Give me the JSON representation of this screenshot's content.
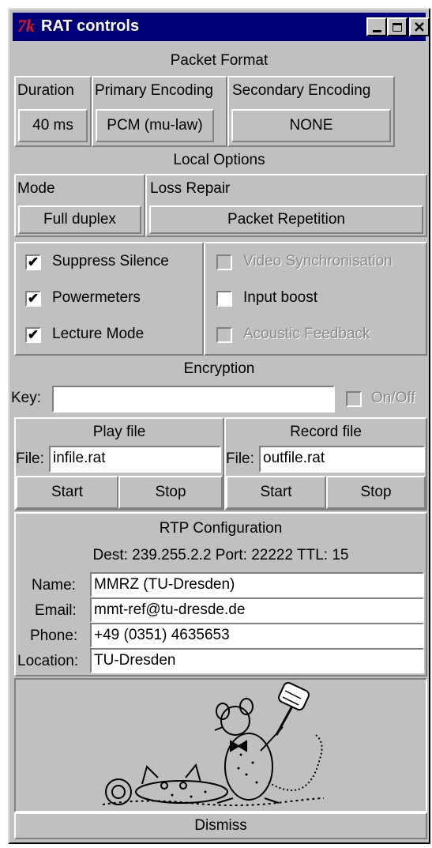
{
  "window": {
    "title": "RAT controls",
    "logo": "7k",
    "icons": [
      "minimize-icon",
      "maximize-icon",
      "close-icon"
    ]
  },
  "packet_format": {
    "heading": "Packet Format",
    "duration": {
      "label": "Duration",
      "value": "40 ms"
    },
    "primary": {
      "label": "Primary Encoding",
      "value": "PCM (mu-law)"
    },
    "secondary": {
      "label": "Secondary Encoding",
      "value": "NONE"
    }
  },
  "local_options": {
    "heading": "Local Options",
    "mode": {
      "label": "Mode",
      "value": "Full duplex"
    },
    "loss_repair": {
      "label": "Loss Repair",
      "value": "Packet Repetition"
    }
  },
  "options": {
    "suppress_silence": {
      "label": "Suppress Silence",
      "checked": true
    },
    "powermeters": {
      "label": "Powermeters",
      "checked": true
    },
    "lecture_mode": {
      "label": "Lecture Mode",
      "checked": true
    },
    "video_sync": {
      "label": "Video Synchronisation",
      "checked": false,
      "enabled": false
    },
    "input_boost": {
      "label": "Input boost",
      "checked": false
    },
    "acoustic_feedback": {
      "label": "Acoustic Feedback",
      "checked": false,
      "enabled": false
    }
  },
  "encryption": {
    "heading": "Encryption",
    "key_label": "Key:",
    "key_value": "",
    "onoff_label": "On/Off"
  },
  "play_file": {
    "heading": "Play file",
    "file_label": "File:",
    "file_value": "infile.rat",
    "start": "Start",
    "stop": "Stop"
  },
  "record_file": {
    "heading": "Record file",
    "file_label": "File:",
    "file_value": "outfile.rat",
    "start": "Start",
    "stop": "Stop"
  },
  "rtp": {
    "heading": "RTP Configuration",
    "dest_line": "Dest: 239.255.2.2  Port: 22222  TTL: 15",
    "name_label": "Name:",
    "name_value": "MMRZ (TU-Dresden)",
    "email_label": "Email:",
    "email_value": "mmt-ref@tu-dresde.de",
    "phone_label": "Phone:",
    "phone_value": "+49 (0351) 4635653",
    "location_label": "Location:",
    "location_value": "TU-Dresden"
  },
  "dismiss": "Dismiss",
  "colors": {
    "titlebar": "#00007b",
    "face": "#c0c0c0",
    "logo": "#e01818"
  }
}
